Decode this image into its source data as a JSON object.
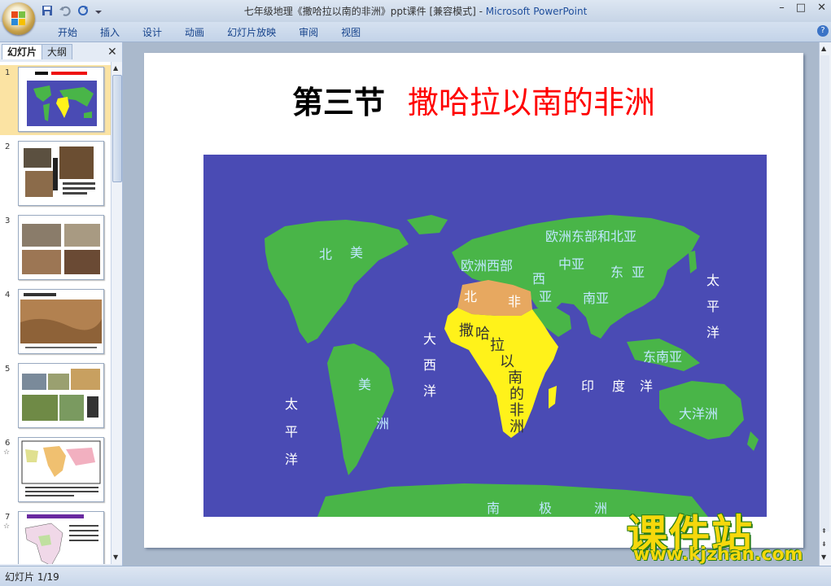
{
  "window": {
    "title_doc": "七年级地理《撒哈拉以南的非洲》ppt课件 [兼容模式] - ",
    "title_app": "Microsoft PowerPoint",
    "controls": [
      "–",
      "□",
      "✕"
    ]
  },
  "ribbon": {
    "tabs": [
      "开始",
      "插入",
      "设计",
      "动画",
      "幻灯片放映",
      "审阅",
      "视图"
    ],
    "help": "?"
  },
  "panel": {
    "tabs": [
      "幻灯片",
      "大纲"
    ],
    "close": "✕",
    "thumbnails": [
      {
        "num": "1",
        "selected": true,
        "has_anim": false
      },
      {
        "num": "2",
        "selected": false,
        "has_anim": false
      },
      {
        "num": "3",
        "selected": false,
        "has_anim": false
      },
      {
        "num": "4",
        "selected": false,
        "has_anim": false
      },
      {
        "num": "5",
        "selected": false,
        "has_anim": false
      },
      {
        "num": "6",
        "selected": false,
        "has_anim": true
      },
      {
        "num": "7",
        "selected": false,
        "has_anim": true
      }
    ],
    "anim_glyph": "☆"
  },
  "slide": {
    "title_black": "第三节",
    "title_red": "撒哈拉以南的非洲",
    "map_labels": {
      "north_america": [
        "北",
        "美"
      ],
      "south_america": [
        "美",
        "洲"
      ],
      "europe_east": "欧洲东部和北亚",
      "europe_west": "欧洲西部",
      "north_africa": [
        "北",
        "非"
      ],
      "west_asia": [
        "西",
        "亚"
      ],
      "central_asia": "中亚",
      "east_asia": [
        "东",
        "亚"
      ],
      "south_asia": "南亚",
      "southeast_asia": "东南亚",
      "atlantic": [
        "大",
        "西",
        "洋"
      ],
      "pacific_left": [
        "太",
        "平",
        "洋"
      ],
      "pacific_right": [
        "太",
        "平",
        "洋"
      ],
      "indian": [
        "印",
        "度",
        "洋"
      ],
      "oceania": "大洋洲",
      "antarctica": [
        "南",
        "极",
        "洲"
      ],
      "sub_sahara": [
        "撒",
        "哈",
        "拉",
        "以",
        "南",
        "的",
        "非",
        "洲"
      ]
    }
  },
  "status": {
    "slide_indicator": "幻灯片 1/19"
  },
  "watermark": {
    "name": "课件站",
    "url": "www.kjzhan.com"
  },
  "colors": {
    "ocean": "#4a4bb4",
    "land": "#49b548",
    "africa_south": "#fff21a",
    "north_africa": "#e7a860",
    "label_cyan": "#bfe8ff",
    "label_dark": "#333333",
    "title_red": "#ff0000"
  }
}
